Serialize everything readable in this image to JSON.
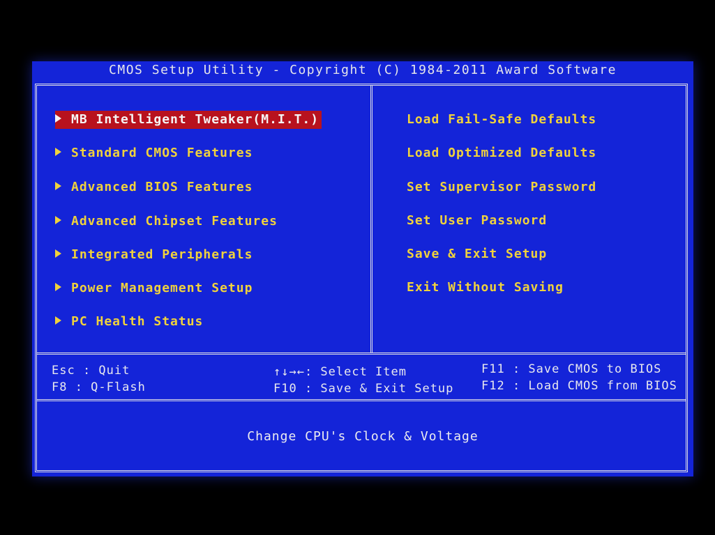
{
  "title": "CMOS Setup Utility - Copyright (C) 1984-2011 Award Software",
  "left_menu": [
    {
      "label": "MB Intelligent Tweaker(M.I.T.)",
      "selected": true
    },
    {
      "label": "Standard CMOS Features",
      "selected": false
    },
    {
      "label": "Advanced BIOS Features",
      "selected": false
    },
    {
      "label": "Advanced Chipset Features",
      "selected": false
    },
    {
      "label": "Integrated Peripherals",
      "selected": false
    },
    {
      "label": "Power Management Setup",
      "selected": false
    },
    {
      "label": "PC Health Status",
      "selected": false
    }
  ],
  "right_menu": [
    {
      "label": "Load Fail-Safe Defaults"
    },
    {
      "label": "Load Optimized Defaults"
    },
    {
      "label": "Set Supervisor Password"
    },
    {
      "label": "Set User Password"
    },
    {
      "label": "Save & Exit Setup"
    },
    {
      "label": "Exit Without Saving"
    }
  ],
  "help": {
    "esc": "Esc  : Quit",
    "f8": "F8   : Q-Flash",
    "arrows": "↑↓→←: Select Item",
    "f10": "F10 : Save & Exit Setup",
    "f11": "F11  : Save CMOS to BIOS",
    "f12": "F12  : Load CMOS from BIOS"
  },
  "status_text": "Change CPU's Clock & Voltage",
  "colors": {
    "background": "#1424d8",
    "item_text": "#f0d23c",
    "highlight": "#b8121e",
    "border": "#dcdce6"
  }
}
